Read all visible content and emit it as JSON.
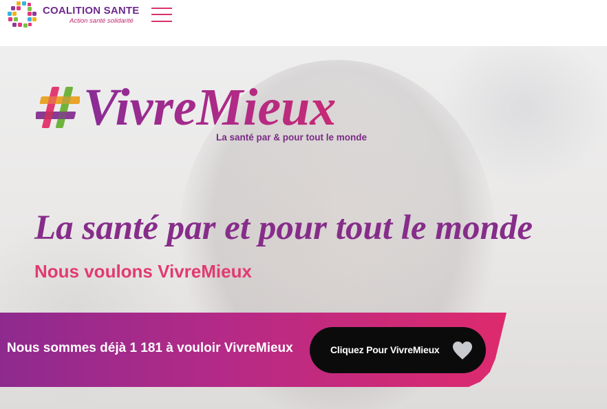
{
  "header": {
    "brand_name": "COALITION SANTE",
    "brand_tagline": "Action santé solidarité",
    "logo_icon": "cross-mosaic-logo-icon",
    "menu_icon": "hamburger-menu-icon",
    "accent_color": "#d8316a",
    "brand_color": "#6d2a8c"
  },
  "hero": {
    "logo_wordmark": "VivreMieux",
    "logo_hash_icon": "hashtag-icon",
    "logo_subtitle": "La santé par & pour tout le monde",
    "title": "La santé par et pour tout le monde",
    "subtitle": "Nous voulons VivreMieux",
    "title_color": "#862d8a",
    "subtitle_color": "#e23a71"
  },
  "banner": {
    "count_text": "Nous sommes déjà 1 181 à vouloir VivreMieux",
    "cta_label": "Cliquez Pour VivreMieux",
    "cta_icon": "heart-icon",
    "gradient_start": "#8e2a8f",
    "gradient_end": "#de2a6e"
  }
}
